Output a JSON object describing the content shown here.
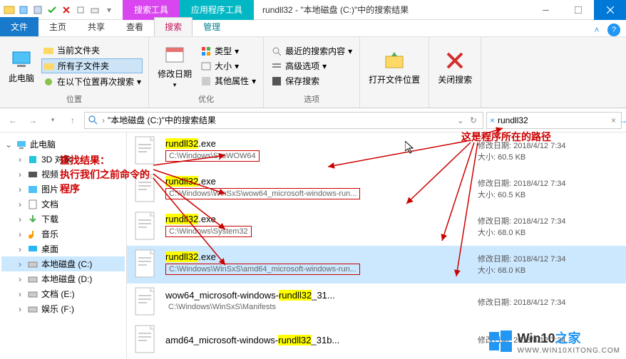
{
  "titlebar": {
    "ctx_tab1": "搜索工具",
    "ctx_tab2": "应用程序工具",
    "title": "rundll32 - \"本地磁盘 (C:)\"中的搜索结果"
  },
  "tabs": {
    "file": "文件",
    "home": "主页",
    "share": "共享",
    "view": "查看",
    "search": "搜索",
    "manage": "管理"
  },
  "ribbon": {
    "this_pc": "此电脑",
    "current_folder": "当前文件夹",
    "all_subfolders": "所有子文件夹",
    "search_again": "在以下位置再次搜索",
    "group_location": "位置",
    "modify_date": "修改日期",
    "type": "类型",
    "size": "大小",
    "other_props": "其他属性",
    "group_refine": "优化",
    "recent_search": "最近的搜索内容",
    "advanced": "高级选项",
    "save_search": "保存搜索",
    "group_options": "选项",
    "open_location": "打开文件位置",
    "close_search": "关闭搜索"
  },
  "addressbar": {
    "path": "\"本地磁盘 (C:)\"中的搜索结果",
    "search_value": "rundll32"
  },
  "tree": {
    "this_pc": "此电脑",
    "obj_3d": "3D 对象",
    "videos": "视频",
    "pictures": "图片",
    "documents": "文档",
    "downloads": "下载",
    "music": "音乐",
    "desktop": "桌面",
    "disk_c": "本地磁盘 (C:)",
    "disk_d": "本地磁盘 (D:)",
    "disk_e": "文档 (E:)",
    "disk_f": "娱乐 (F:)"
  },
  "annotations": {
    "find_result_1": "查找结果：",
    "find_result_2": "执行我们之前命令的",
    "find_result_3": "程序",
    "path_label": "这是程序所在的路径"
  },
  "results": [
    {
      "name_pre": "",
      "name_hl": "rundll32",
      "name_post": ".exe",
      "path": "C:\\Windows\\SysWOW64",
      "date_label": "修改日期:",
      "date": "2018/4/12 7:34",
      "size_label": "大小:",
      "size": "60.5 KB"
    },
    {
      "name_pre": "",
      "name_hl": "rundll32",
      "name_post": ".exe",
      "path": "C:\\Windows\\WinSxS\\wow64_microsoft-windows-run...",
      "date_label": "修改日期:",
      "date": "2018/4/12 7:34",
      "size_label": "大小:",
      "size": "60.5 KB"
    },
    {
      "name_pre": "",
      "name_hl": "rundll32",
      "name_post": ".exe",
      "path": "C:\\Windows\\System32",
      "date_label": "修改日期:",
      "date": "2018/4/12 7:34",
      "size_label": "大小:",
      "size": "68.0 KB"
    },
    {
      "name_pre": "",
      "name_hl": "rundll32",
      "name_post": ".exe",
      "path": "C:\\Windows\\WinSxS\\amd64_microsoft-windows-run...",
      "date_label": "修改日期:",
      "date": "2018/4/12 7:34",
      "size_label": "大小:",
      "size": "68.0 KB",
      "selected": true
    },
    {
      "name_pre": "wow64_microsoft-windows-",
      "name_hl": "rundll32",
      "name_post": "_31...",
      "path": "C:\\Windows\\WinSxS\\Manifests",
      "date_label": "修改日期:",
      "date": "2018/4/12 7:34",
      "size_label": "",
      "size": ""
    },
    {
      "name_pre": "amd64_microsoft-windows-",
      "name_hl": "rundll32",
      "name_post": "_31b...",
      "path": "",
      "date_label": "修改日期:",
      "date": "2018/4/12 7:34",
      "size_label": "",
      "size": ""
    }
  ],
  "watermark": {
    "brand": "Win10",
    "suffix": "之家",
    "url": "WWW.WIN10XITONG.COM"
  }
}
